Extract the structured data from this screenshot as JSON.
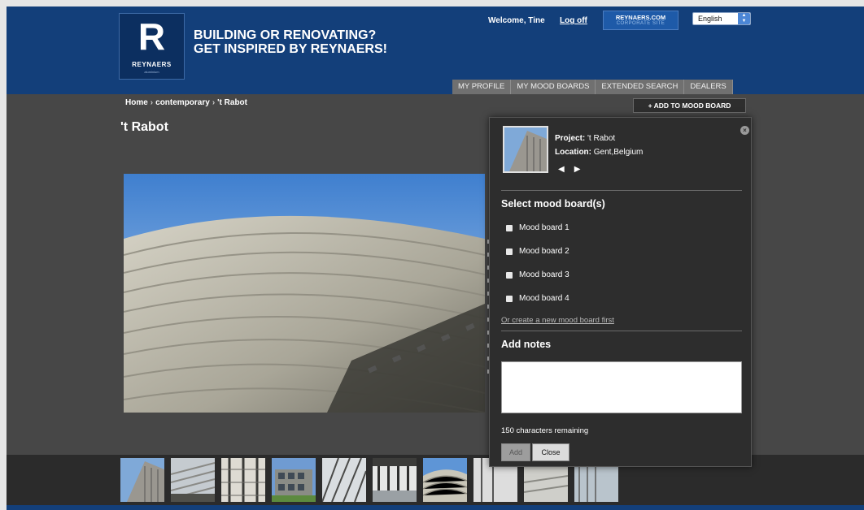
{
  "header": {
    "logo_letter": "R",
    "logo_brand": "REYNAERS",
    "logo_sub": "aluminium",
    "tagline_line1": "BUILDING OR RENOVATING?",
    "tagline_line2": "GET INSPIRED BY REYNAERS!",
    "welcome": "Welcome, Tine",
    "logoff": "Log off",
    "corporate_line1": "REYNAERS.COM",
    "corporate_line2": "CORPORATE SITE",
    "language": "English"
  },
  "nav": {
    "tabs": [
      "MY PROFILE",
      "MY MOOD BOARDS",
      "EXTENDED SEARCH",
      "DEALERS"
    ]
  },
  "breadcrumb": {
    "items": [
      "Home",
      "contemporary",
      "'t Rabot"
    ],
    "separator": "›"
  },
  "page": {
    "title": "'t Rabot",
    "add_to_board": "+ ADD TO MOOD BOARD"
  },
  "panel": {
    "project_label": "Project:",
    "project_value": "'t Rabot",
    "location_label": "Location:",
    "location_value": "Gent,Belgium",
    "prev_arrow": "◀",
    "next_arrow": "▶",
    "close_icon": "×",
    "select_heading": "Select mood board(s)",
    "boards": [
      "Mood board 1",
      "Mood board 2",
      "Mood board 3",
      "Mood board 4"
    ],
    "create_link": "Or create a new mood board first",
    "notes_heading": "Add notes",
    "notes_value": "",
    "remaining": "150 characters remaining",
    "add_button": "Add",
    "close_button": "Close"
  },
  "colors": {
    "brand_blue": "#133f7a",
    "background": "#474747",
    "panel": "#2d2d2d"
  },
  "icons": [
    "close-icon",
    "prev-arrow-icon",
    "next-arrow-icon",
    "checkbox-icon",
    "dropdown-arrow-icon"
  ]
}
